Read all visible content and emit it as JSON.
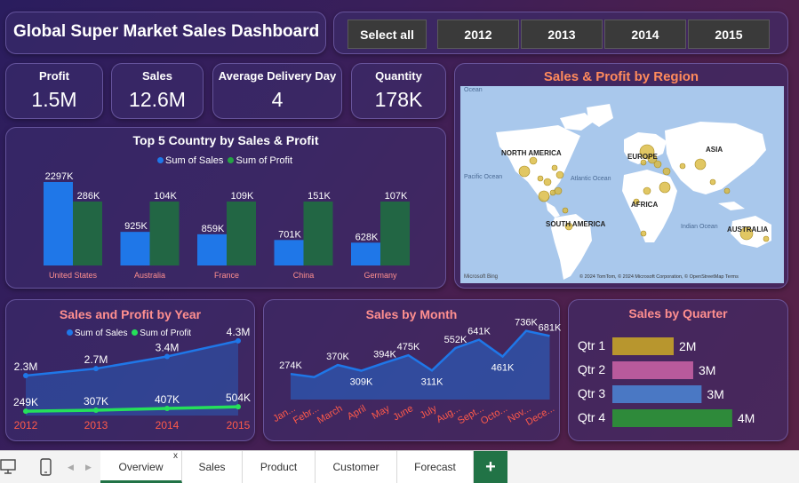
{
  "title": "Global Super Market Sales Dashboard",
  "slicer": [
    "Select all",
    "2012",
    "2013",
    "2014",
    "2015"
  ],
  "kpis": [
    {
      "label": "Profit",
      "value": "1.5M"
    },
    {
      "label": "Sales",
      "value": "12.6M"
    },
    {
      "label": "Average Delivery Day",
      "value": "4"
    },
    {
      "label": "Quantity",
      "value": "178K"
    }
  ],
  "map": {
    "title": "Sales & Profit by Region",
    "labels": [
      "NORTH AMERICA",
      "EUROPE",
      "ASIA",
      "AFRICA",
      "SOUTH AMERICA",
      "AUSTRALIA"
    ],
    "ocean_labels": [
      "Pacific Ocean",
      "Atlantic Ocean",
      "Indian Ocean",
      "Ocean"
    ],
    "attribution": "© 2024 TomTom, © 2024 Microsoft Corporation, © OpenStreetMap  Terms",
    "bing": "Microsoft Bing"
  },
  "colors": {
    "sales": "#1f77e8",
    "profit": "#25a244",
    "accent_title": "#ff8f8f",
    "map_title": "#ff8a5c"
  },
  "chart_data": [
    {
      "type": "bar",
      "title": "Top 5 Country by Sales & Profit",
      "categories": [
        "United States",
        "Australia",
        "France",
        "China",
        "Germany"
      ],
      "series": [
        {
          "name": "Sum of Sales",
          "values": [
            2297,
            925,
            859,
            701,
            628
          ],
          "labels": [
            "2297K",
            "925K",
            "859K",
            "701K",
            "628K"
          ]
        },
        {
          "name": "Sum of Profit",
          "values": [
            286,
            104,
            109,
            151,
            107
          ],
          "labels": [
            "286K",
            "104K",
            "109K",
            "151K",
            "107K"
          ]
        }
      ]
    },
    {
      "type": "line",
      "title": "Sales and Profit by Year",
      "categories": [
        "2012",
        "2013",
        "2014",
        "2015"
      ],
      "series": [
        {
          "name": "Sum of Sales",
          "values": [
            2.3,
            2.7,
            3.4,
            4.3
          ],
          "labels": [
            "2.3M",
            "2.7M",
            "3.4M",
            "4.3M"
          ]
        },
        {
          "name": "Sum of Profit",
          "values": [
            0.249,
            0.307,
            0.407,
            0.504
          ],
          "labels": [
            "249K",
            "307K",
            "407K",
            "504K"
          ]
        }
      ]
    },
    {
      "type": "area",
      "title": "Sales by Month",
      "categories": [
        "Jan...",
        "Febr...",
        "March",
        "April",
        "May",
        "June",
        "July",
        "Aug...",
        "Sept...",
        "Octo...",
        "Nov...",
        "Dece..."
      ],
      "values": [
        274,
        240,
        370,
        309,
        394,
        475,
        311,
        552,
        641,
        461,
        736,
        681
      ],
      "labels": [
        "274K",
        "",
        "370K",
        "309K",
        "394K",
        "475K",
        "311K",
        "552K",
        "641K",
        "461K",
        "736K",
        "681K"
      ]
    },
    {
      "type": "bar",
      "title": "Sales by Quarter",
      "categories": [
        "Qtr 1",
        "Qtr 2",
        "Qtr 3",
        "Qtr 4"
      ],
      "values": [
        2.2,
        2.9,
        3.2,
        4.3
      ],
      "labels": [
        "2M",
        "3M",
        "3M",
        "4M"
      ],
      "colors": [
        "#b8962e",
        "#b85a9c",
        "#4a78c4",
        "#2e8a3a"
      ]
    }
  ],
  "tabs": [
    "Overview",
    "Sales",
    "Product",
    "Customer",
    "Forecast"
  ],
  "tab_close": "x",
  "tab_add": "+"
}
